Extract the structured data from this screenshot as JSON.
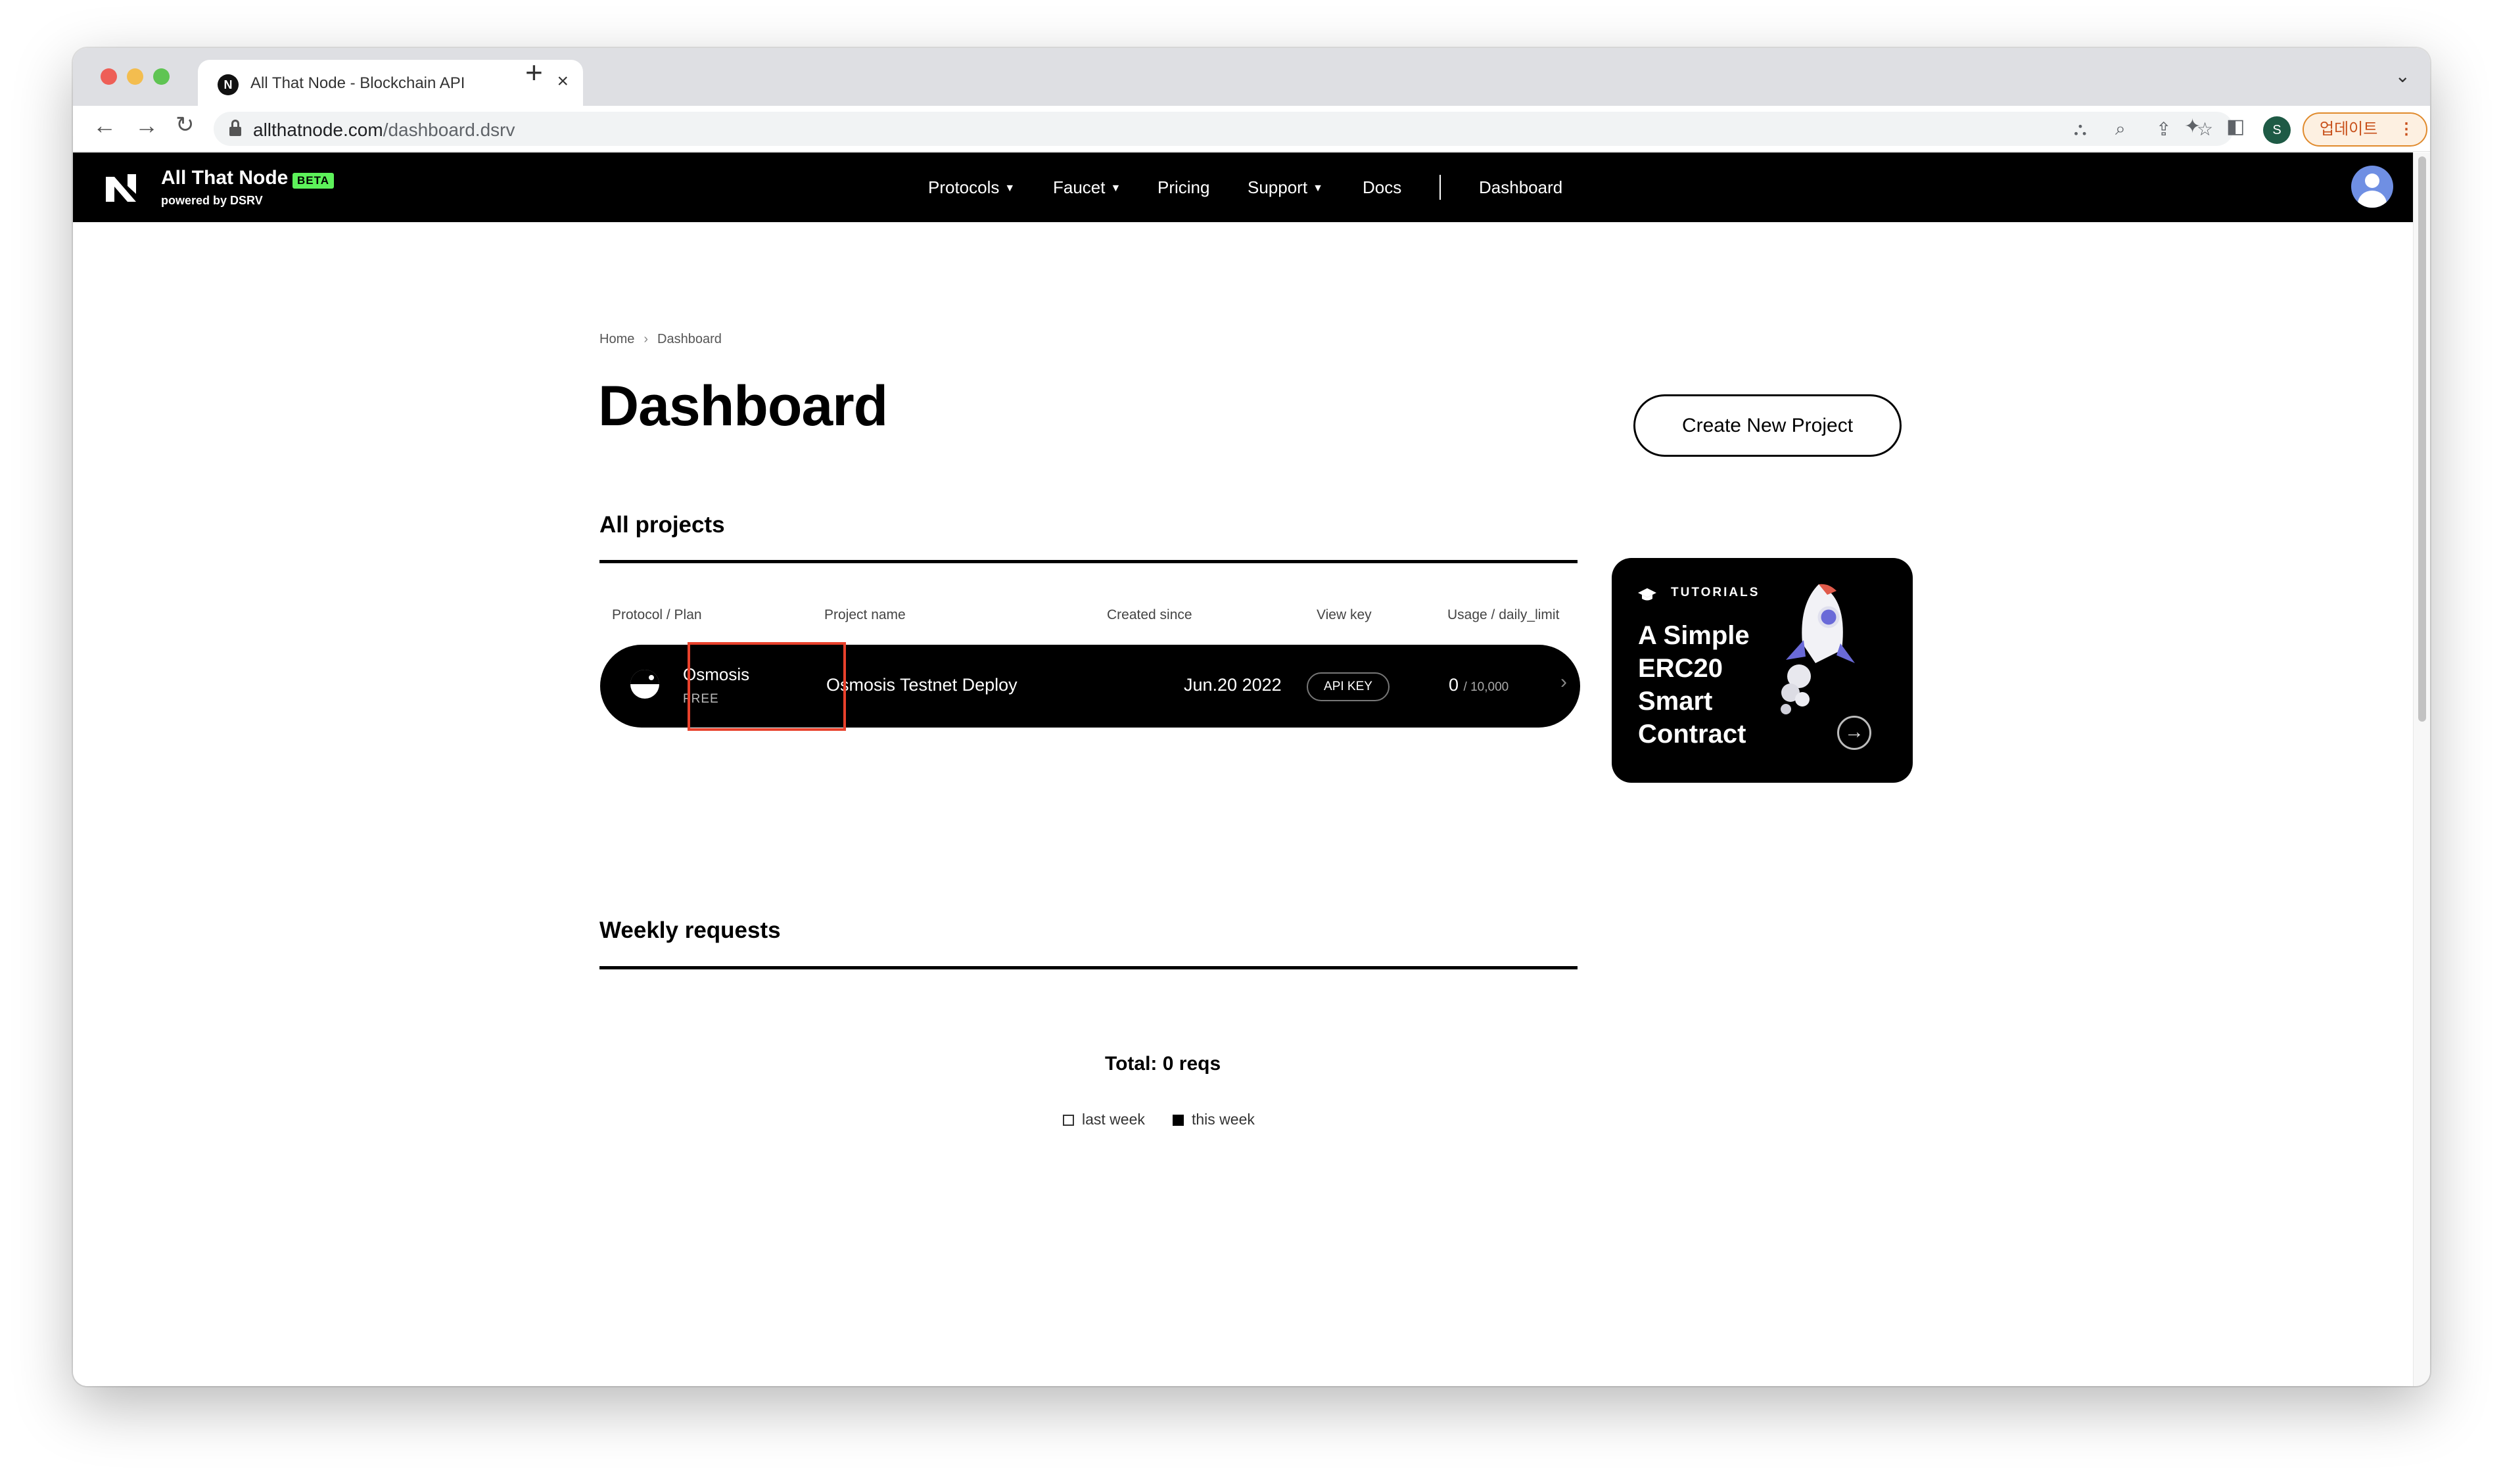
{
  "browser": {
    "tab_title": "All That Node - Blockchain API",
    "tab_close": "×",
    "new_tab": "+",
    "url_domain": "allthatnode.com",
    "url_path": "/dashboard.dsrv",
    "profile_initial": "S",
    "update_label": "업데이트",
    "update_menu": "⋮"
  },
  "site": {
    "brand": "All That Node",
    "beta": "BETA",
    "powered_by": "powered by DSRV",
    "nav": {
      "protocols": "Protocols",
      "faucet": "Faucet",
      "pricing": "Pricing",
      "support": "Support",
      "docs": "Docs",
      "dashboard": "Dashboard"
    }
  },
  "breadcrumb": {
    "home": "Home",
    "current": "Dashboard"
  },
  "page": {
    "title": "Dashboard",
    "create_button": "Create New Project"
  },
  "projects": {
    "section_title": "All projects",
    "columns": {
      "protocol": "Protocol / Plan",
      "name": "Project name",
      "created": "Created since",
      "key": "View key",
      "usage": "Usage / daily_limit"
    },
    "rows": [
      {
        "protocol": "Osmosis",
        "plan": "FREE",
        "name": "Osmosis Testnet Deploy",
        "created": "Jun.20 2022",
        "key_button": "API KEY",
        "usage": "0",
        "limit": "/ 10,000"
      }
    ]
  },
  "tutorial": {
    "label": "TUTORIALS",
    "lines": [
      "A Simple",
      "ERC20",
      "Smart",
      "Contract"
    ],
    "arrow": "→"
  },
  "weekly": {
    "section_title": "Weekly requests",
    "total": "Total: 0 reqs",
    "legend_last": "last week",
    "legend_this": "this week"
  }
}
